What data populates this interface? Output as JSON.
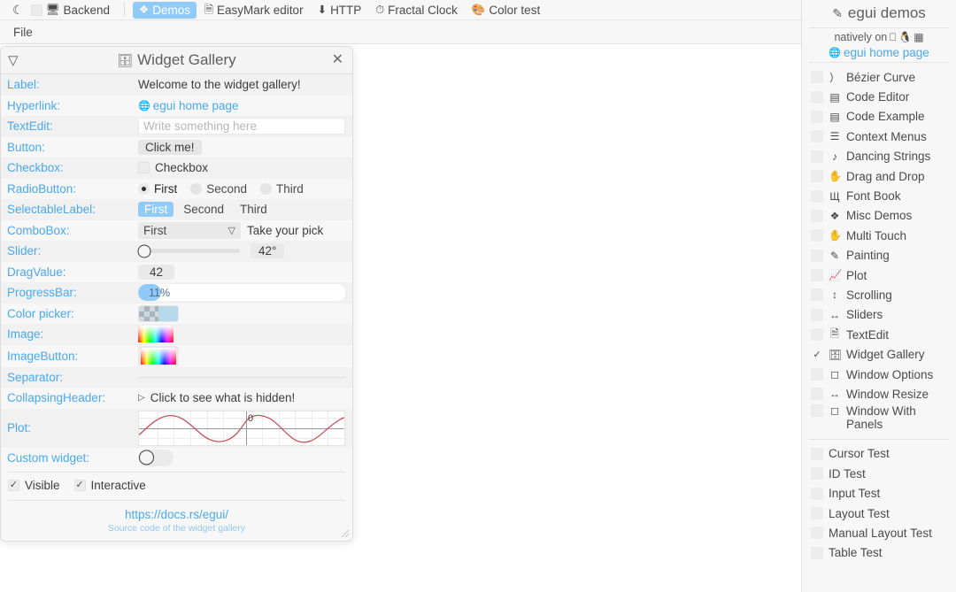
{
  "topbar": {
    "theme_toggle_icon": "moon-icon",
    "backend_checkbox_checked": false,
    "backend_icon": "monitor-icon",
    "backend_label": "Backend",
    "tabs": [
      {
        "icon": "diamonds-icon",
        "label": "Demos",
        "active": true
      },
      {
        "icon": "document-icon",
        "label": "EasyMark editor",
        "active": false
      },
      {
        "icon": "download-icon",
        "label": "HTTP",
        "active": false
      },
      {
        "icon": "clock-icon",
        "label": "Fractal Clock",
        "active": false
      },
      {
        "icon": "palette-icon",
        "label": "Color test",
        "active": false
      }
    ]
  },
  "menubar": {
    "items": [
      "File"
    ]
  },
  "gallery": {
    "collapse_icon": "triangle-down-icon",
    "title_icon": "cabinet-icon",
    "title": "Widget Gallery",
    "close_icon": "close-icon",
    "rows": [
      {
        "label": "Label:",
        "value": "Welcome to the widget gallery!"
      },
      {
        "label": "Hyperlink:",
        "value": "egui home page",
        "icon": "globe-icon"
      },
      {
        "label": "TextEdit:",
        "value": "",
        "placeholder": "Write something here"
      },
      {
        "label": "Button:",
        "value": "Click me!"
      },
      {
        "label": "Checkbox:",
        "value": "Checkbox",
        "checked": false
      },
      {
        "label": "RadioButton:",
        "options": [
          "First",
          "Second",
          "Third"
        ],
        "selected": "First"
      },
      {
        "label": "SelectableLabel:",
        "options": [
          "First",
          "Second",
          "Third"
        ],
        "selected": "First"
      },
      {
        "label": "ComboBox:",
        "value": "First",
        "hint": "Take your pick"
      },
      {
        "label": "Slider:",
        "value": "42°",
        "percent": 0
      },
      {
        "label": "DragValue:",
        "value": "42"
      },
      {
        "label": "ProgressBar:",
        "value": "11%",
        "percent": 11
      },
      {
        "label": "Color picker:"
      },
      {
        "label": "Image:"
      },
      {
        "label": "ImageButton:"
      },
      {
        "label": "Separator:"
      },
      {
        "label": "CollapsingHeader:",
        "value": "Click to see what is hidden!",
        "arrow": "▷"
      },
      {
        "label": "Plot:",
        "zero_label": "0"
      },
      {
        "label": "Custom widget:",
        "on": false
      }
    ],
    "bottom_checks": [
      {
        "label": "Visible",
        "checked": true
      },
      {
        "label": "Interactive",
        "checked": true
      }
    ],
    "footer_link": "https://docs.rs/egui/",
    "footer_sub": "Source code of the widget gallery"
  },
  "rightpanel": {
    "title_icon": "pencil-icon",
    "title": "egui demos",
    "natively_on": "natively on",
    "platform_icons": [
      "apple-icon",
      "linux-icon",
      "windows-icon"
    ],
    "home_link": "egui home page",
    "home_icon": "globe-icon",
    "demos": [
      {
        "icon": "❯",
        "icon_name": "bezier-icon",
        "label": "Bézier Curve",
        "checked": false
      },
      {
        "icon": "☰",
        "icon_name": "code-icon",
        "label": "Code Editor",
        "checked": false
      },
      {
        "icon": "☰",
        "icon_name": "code-icon",
        "label": "Code Example",
        "checked": false
      },
      {
        "icon": "☰",
        "icon_name": "menu-icon",
        "label": "Context Menus",
        "checked": false
      },
      {
        "icon": "♫",
        "icon_name": "music-note-icon",
        "label": "Dancing Strings",
        "checked": false
      },
      {
        "icon": "✋",
        "icon_name": "hand-icon",
        "label": "Drag and Drop",
        "checked": false
      },
      {
        "icon": "Щ",
        "icon_name": "font-icon",
        "label": "Font Book",
        "checked": false
      },
      {
        "icon": "❖",
        "icon_name": "diamonds-icon",
        "label": "Misc Demos",
        "checked": false
      },
      {
        "icon": "✋",
        "icon_name": "multi-touch-icon",
        "label": "Multi Touch",
        "checked": false
      },
      {
        "icon": "✒",
        "icon_name": "pencil-icon",
        "label": "Painting",
        "checked": false
      },
      {
        "icon": "ᵛ",
        "icon_name": "plot-icon",
        "label": "Plot",
        "checked": false
      },
      {
        "icon": "↕",
        "icon_name": "scroll-icon",
        "label": "Scrolling",
        "checked": false
      },
      {
        "icon": "↔",
        "icon_name": "slider-icon",
        "label": "Sliders",
        "checked": false
      },
      {
        "icon": "☰",
        "icon_name": "document-icon",
        "label": "TextEdit",
        "checked": false
      },
      {
        "icon": "▤",
        "icon_name": "cabinet-icon",
        "label": "Widget Gallery",
        "checked": true
      },
      {
        "icon": "□",
        "icon_name": "window-icon",
        "label": "Window Options",
        "checked": false
      },
      {
        "icon": "↔",
        "icon_name": "resize-icon",
        "label": "Window Resize",
        "checked": false
      },
      {
        "icon": "□",
        "icon_name": "window-icon",
        "label": "Window With Panels",
        "checked": false,
        "wrap": true
      }
    ],
    "tests": [
      {
        "label": "Cursor Test",
        "checked": false
      },
      {
        "label": "ID Test",
        "checked": false
      },
      {
        "label": "Input Test",
        "checked": false
      },
      {
        "label": "Layout Test",
        "checked": false
      },
      {
        "label": "Manual Layout Test",
        "checked": false
      },
      {
        "label": "Table Test",
        "checked": false
      }
    ]
  },
  "colors": {
    "accent": "#90caf9",
    "link": "#49a8f0",
    "panel_bg": "#f7f7f7",
    "plot_line": "#c4515a"
  }
}
